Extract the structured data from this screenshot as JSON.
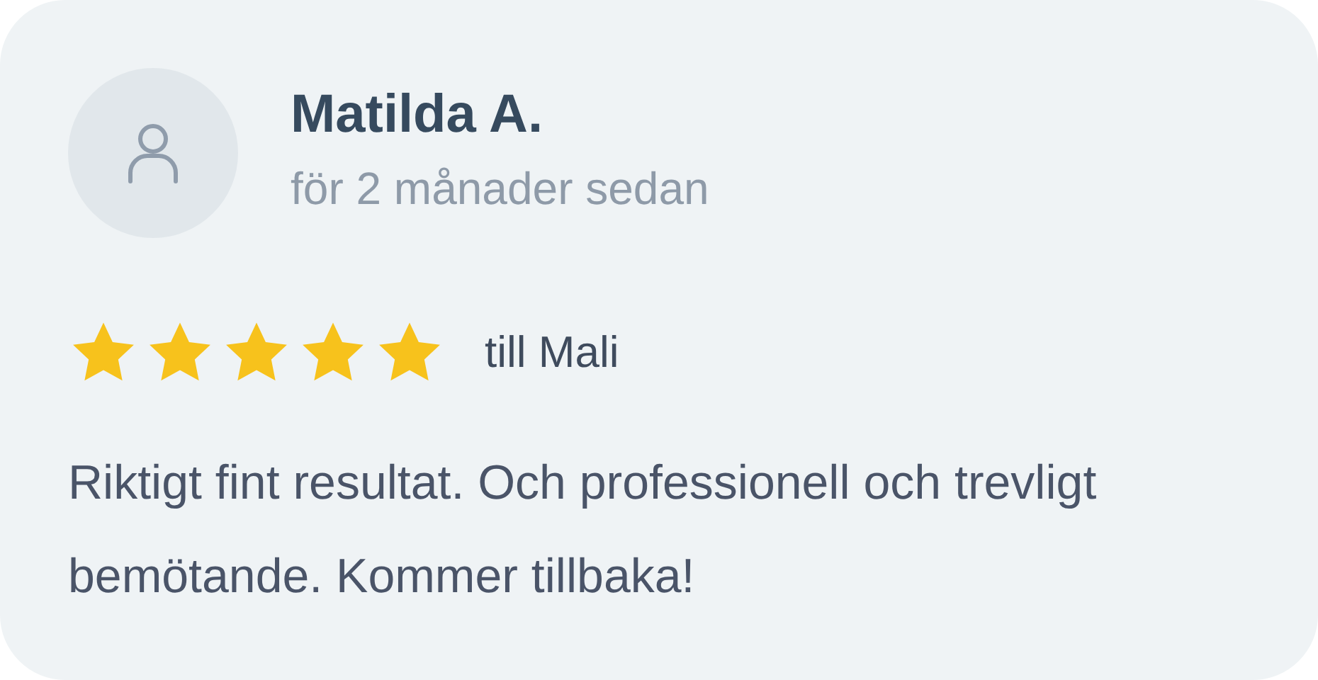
{
  "review": {
    "author": "Matilda A.",
    "time": "för 2 månader sedan",
    "stars": 5,
    "target": "till Mali",
    "text": "Riktigt fint resultat. Och professionell och trevligt bemötande. Kommer tillbaka!"
  }
}
